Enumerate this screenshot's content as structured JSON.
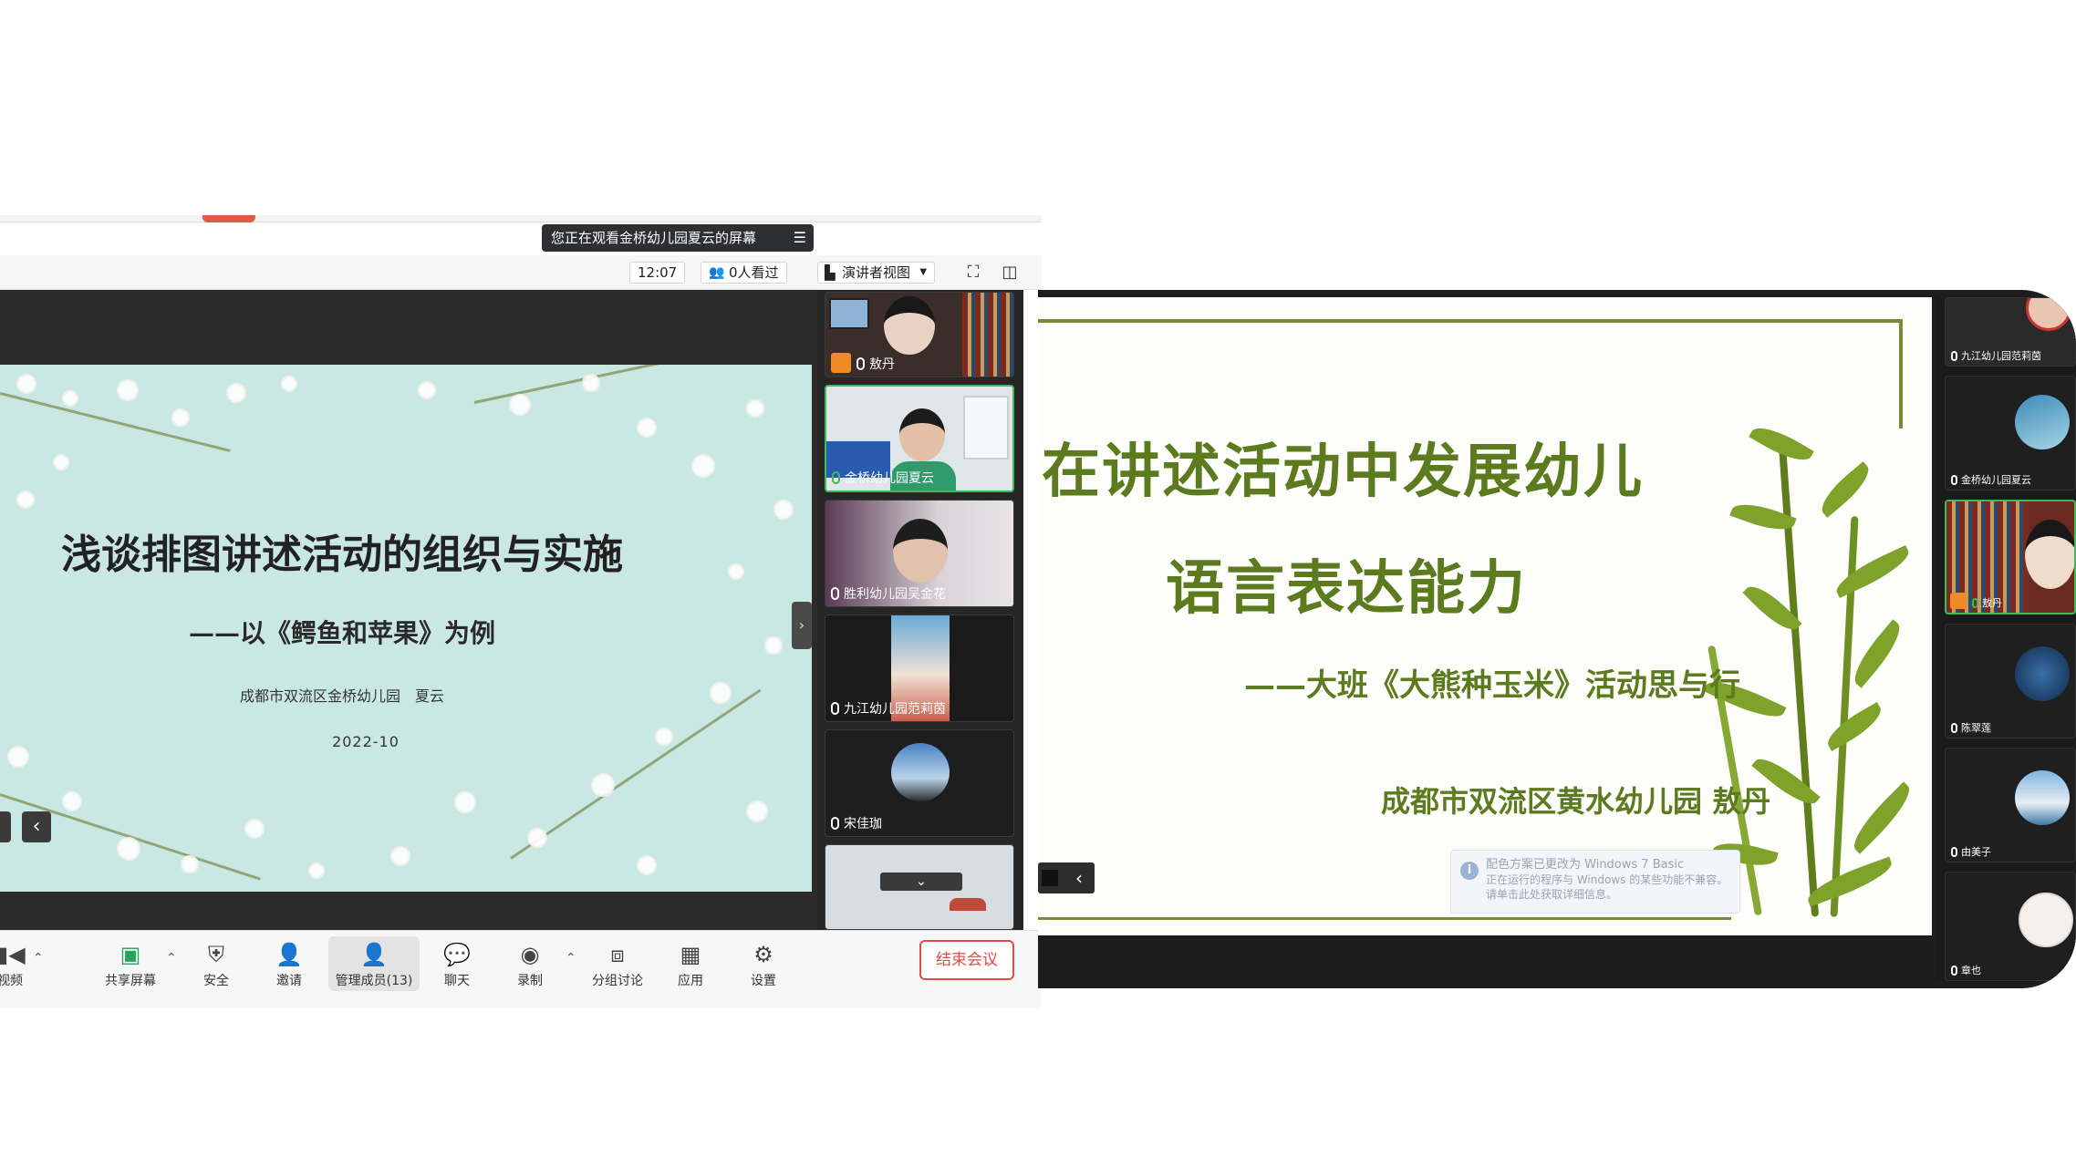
{
  "left": {
    "banner_text": "您正在观看金桥幼儿园夏云的屏幕",
    "toolbar": {
      "time": "12:07",
      "viewers": "0人看过",
      "view_mode": "演讲者视图"
    },
    "slide": {
      "title": "浅谈排图讲述活动的组织与实施",
      "subtitle": "——以《鳄鱼和苹果》为例",
      "author": "成都市双流区金桥幼儿园　夏云",
      "date": "2022-10"
    },
    "participants": [
      {
        "name": "敖丹"
      },
      {
        "name": "金桥幼儿园夏云"
      },
      {
        "name": "胜利幼儿园吴金花"
      },
      {
        "name": "九江幼儿园范莉茵"
      },
      {
        "name": "宋佳珈"
      }
    ],
    "bottombar": {
      "video": "视频",
      "share": "共享屏幕",
      "security": "安全",
      "invite": "邀请",
      "manage": "管理成员(13)",
      "chat": "聊天",
      "record": "录制",
      "breakout": "分组讨论",
      "apps": "应用",
      "settings": "设置",
      "end": "结束会议"
    }
  },
  "right": {
    "slide": {
      "title_line1": "在讲述活动中发展幼儿",
      "title_line2": "语言表达能力",
      "subtitle": "——大班《大熊种玉米》活动思与行",
      "author": "成都市双流区黄水幼儿园 敖丹"
    },
    "notice": {
      "line1": "配色方案已更改为 Windows 7 Basic",
      "line2": "正在运行的程序与 Windows 的某些功能不兼容。",
      "line3": "请单击此处获取详细信息。"
    },
    "participants": [
      {
        "name": "九江幼儿园范莉茵"
      },
      {
        "name": "金桥幼儿园夏云"
      },
      {
        "name": "敖丹"
      },
      {
        "name": "陈翠莲"
      },
      {
        "name": "由美子"
      },
      {
        "name": "章也"
      }
    ]
  },
  "colors": {
    "slide_green": "#5c7a1e",
    "end_red": "#e34a4a",
    "left_slide_bg": "#c9e8e4"
  }
}
